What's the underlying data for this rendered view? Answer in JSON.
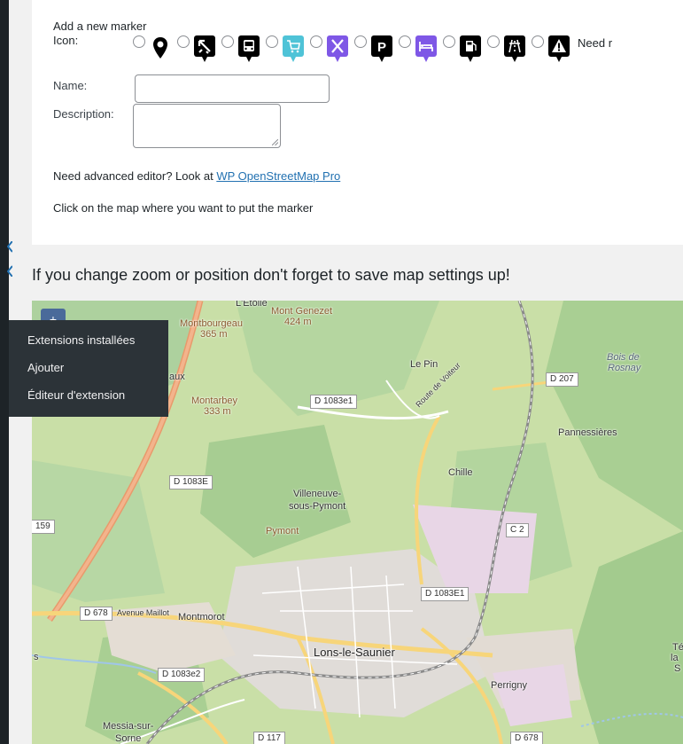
{
  "marker_form": {
    "title": "Add a new marker",
    "icon_label": "Icon:",
    "icons": [
      {
        "name": "black-pin-icon",
        "color": "#000000"
      },
      {
        "name": "airport-icon",
        "color": "#000000"
      },
      {
        "name": "bus-icon",
        "color": "#000000"
      },
      {
        "name": "shopping-cart-icon",
        "color": "#4fc3d7"
      },
      {
        "name": "restaurant-icon",
        "color": "#7e57e6"
      },
      {
        "name": "parking-icon",
        "color": "#000000"
      },
      {
        "name": "hotel-icon",
        "color": "#7e57e6"
      },
      {
        "name": "fuel-station-icon",
        "color": "#000000"
      },
      {
        "name": "highway-icon",
        "color": "#000000"
      },
      {
        "name": "warning-icon",
        "color": "#000000"
      }
    ],
    "need_more_text": "Need r",
    "name_label": "Name:",
    "name_value": "",
    "description_label": "Description:",
    "description_value": "",
    "advanced_text": "Need advanced editor? Look at ",
    "advanced_link": "WP OpenStreetMap Pro",
    "click_hint": "Click on the map where you want to put the marker"
  },
  "warning": "If you change zoom or position don't forget to save map settings up!",
  "flyout_menu": {
    "items": [
      "Extensions installées",
      "Ajouter",
      "Éditeur d'extension"
    ]
  },
  "map": {
    "zoom_in": "+",
    "places": {
      "etoile": "L'Étoile",
      "mont_genezet": "Mont Genezet",
      "mont_genezet_alt": "424 m",
      "montbourgeau": "Montbourgeau",
      "montbourgeau_alt": "365 m",
      "montarbey": "Montarbey",
      "montarbey_alt": "333 m",
      "aux": "aux",
      "le_pin": "Le Pin",
      "bois_de_rosnay": "Bois de",
      "bois_de_rosnay_2": "Rosnay",
      "pannessieres": "Pannessières",
      "chille": "Chille",
      "villeneuve": "Villeneuve-",
      "villeneuve_2": "sous-Pymont",
      "pymont": "Pymont",
      "montmorot": "Montmorot",
      "lons": "Lons-le-Saunier",
      "perrigny": "Perrigny",
      "messia": "Messia-sur-",
      "messia_2": "Sorne",
      "te": "Té",
      "te_2": "la",
      "te_3": "S"
    },
    "roads": {
      "d1083e1_top": "D 1083e1",
      "d207": "D 207",
      "route_voiteur": "Route de Voiteur",
      "d1083e": "D 1083E",
      "r159": "159",
      "c2": "C 2",
      "d1083e1_mid": "D 1083E1",
      "d678_left": "D 678",
      "avenue_maillot": "Avenue Maillot",
      "d1083e2": "D 1083e2",
      "d117": "D 117",
      "d678_bottom": "D 678",
      "s": "s"
    }
  }
}
